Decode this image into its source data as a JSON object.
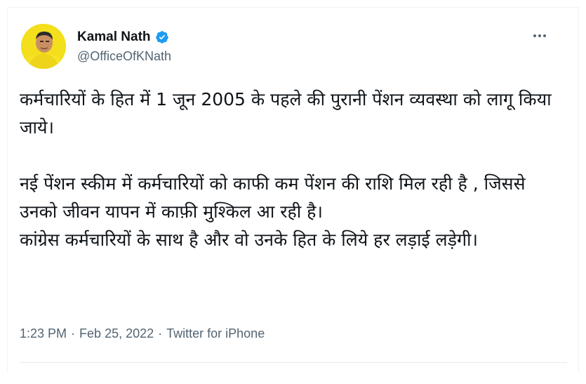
{
  "author": {
    "display_name": "Kamal Nath",
    "handle": "@OfficeOfKNath",
    "verified": true,
    "avatar_icon": "profile-photo",
    "verified_color": "#1d9bf0"
  },
  "tweet": {
    "paragraph_1": "कर्मचारियों के हित में 1 जून 2005 के पहले की पुरानी पेंशन व्यवस्था को लागू किया जाये।",
    "paragraph_2_line_1": "नई पेंशन स्कीम में कर्मचारियों को काफी कम पेंशन की राशि मिल रही है , जिससे उनको जीवन यापन में काफ़ी मुश्किल आ रही है।",
    "paragraph_2_line_2": "कांग्रेस कर्मचारियों के साथ है और वो उनके हित के लिये हर लड़ाई लड़ेगी।"
  },
  "meta": {
    "time": "1:23 PM",
    "separator": "·",
    "date": "Feb 25, 2022",
    "source": "Twitter for iPhone"
  },
  "menu": {
    "icon": "more-horizontal-icon"
  },
  "colors": {
    "text": "#0f1419",
    "secondary": "#536471",
    "accent": "#1d9bf0"
  }
}
